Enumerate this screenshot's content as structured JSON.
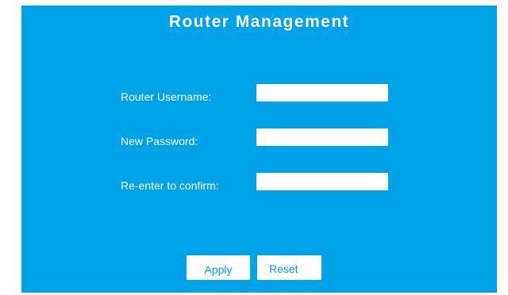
{
  "page": {
    "title": "Router Management"
  },
  "form": {
    "username_label": "Router Username:",
    "username_value": "",
    "new_password_label": "New Password:",
    "new_password_value": "",
    "confirm_label": "Re-enter to confirm:",
    "confirm_value": ""
  },
  "actions": {
    "apply_label": "Apply",
    "reset_label": "Reset"
  },
  "colors": {
    "panel_background": "#00a2e8",
    "field_background": "#ffffff",
    "text": "#ffffff"
  }
}
